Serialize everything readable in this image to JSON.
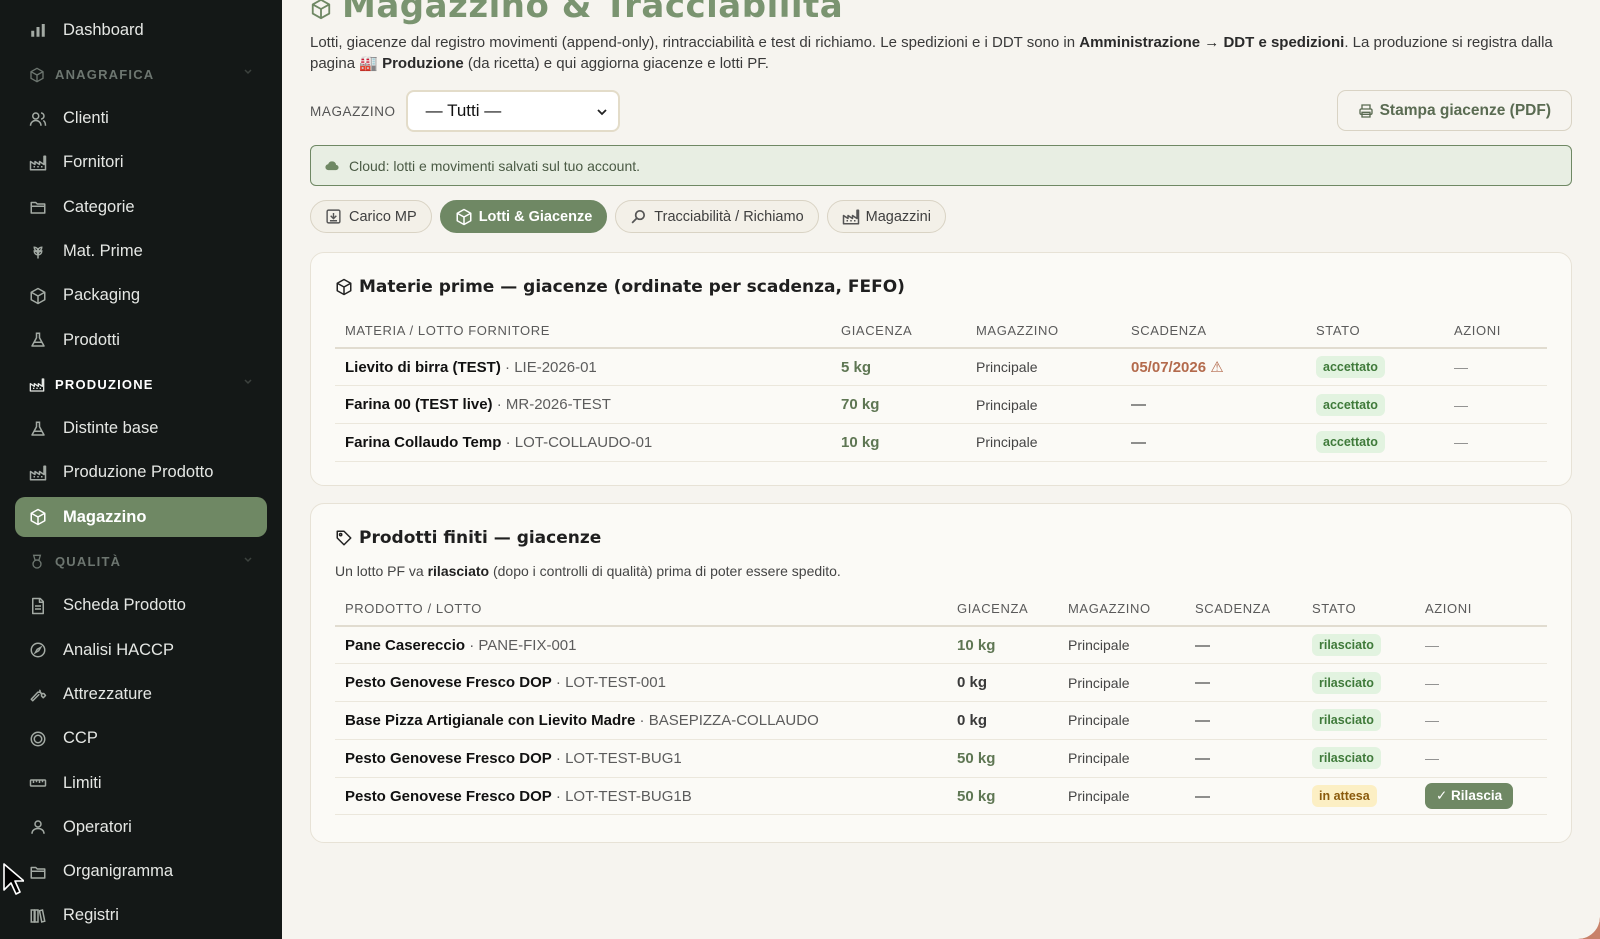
{
  "sidebar": {
    "items": [
      {
        "type": "item",
        "icon": "chart-icon",
        "label": "Dashboard"
      },
      {
        "type": "section",
        "icon": "box-icon",
        "label": "ANAGRAFICA"
      },
      {
        "type": "item",
        "icon": "users-icon",
        "label": "Clienti"
      },
      {
        "type": "item",
        "icon": "factory-icon",
        "label": "Fornitori"
      },
      {
        "type": "item",
        "icon": "folder-icon",
        "label": "Categorie"
      },
      {
        "type": "item",
        "icon": "wheat-icon",
        "label": "Mat. Prime"
      },
      {
        "type": "item",
        "icon": "box-icon",
        "label": "Packaging"
      },
      {
        "type": "item",
        "icon": "flask-icon",
        "label": "Prodotti"
      },
      {
        "type": "section",
        "icon": "factory-icon",
        "label": "PRODUZIONE"
      },
      {
        "type": "item",
        "icon": "flask-icon",
        "label": "Distinte base"
      },
      {
        "type": "item",
        "icon": "factory-icon",
        "label": "Produzione Prodotto"
      },
      {
        "type": "item",
        "icon": "box-icon",
        "label": "Magazzino",
        "active": true
      },
      {
        "type": "section",
        "icon": "medal-icon",
        "label": "QUALITÀ"
      },
      {
        "type": "item",
        "icon": "document-icon",
        "label": "Scheda Prodotto"
      },
      {
        "type": "item",
        "icon": "compass-icon",
        "label": "Analisi HACCP"
      },
      {
        "type": "item",
        "icon": "wrench-icon",
        "label": "Attrezzature"
      },
      {
        "type": "item",
        "icon": "target-icon",
        "label": "CCP"
      },
      {
        "type": "item",
        "icon": "ruler-icon",
        "label": "Limiti"
      },
      {
        "type": "item",
        "icon": "user-icon",
        "label": "Operatori"
      },
      {
        "type": "item",
        "icon": "folder-icon",
        "label": "Organigramma"
      },
      {
        "type": "item",
        "icon": "books-icon",
        "label": "Registri"
      }
    ]
  },
  "header": {
    "title": "Magazzino & Tracciabilità",
    "intro_1": "Lotti, giacenze dal registro movimenti (append-only), rintracciabilità e test di richiamo. Le spedizioni e i DDT sono in ",
    "intro_2": "Amministrazione → DDT e spedizioni",
    "intro_3": ". La produzione si registra dalla pagina 🏭 ",
    "intro_4": "Produzione",
    "intro_5": " (da ricetta) e qui aggiorna giacenze e lotti PF."
  },
  "toolbar": {
    "warehouse_label": "MAGAZZINO",
    "warehouse_value": "— Tutti —",
    "print_label": "Stampa giacenze (PDF)"
  },
  "cloud_notice": "Cloud: lotti e movimenti salvati sul tuo account.",
  "tabs": [
    {
      "icon": "download-icon",
      "label": "Carico MP"
    },
    {
      "icon": "box-icon",
      "label": "Lotti & Giacenze",
      "active": true
    },
    {
      "icon": "magnifier-icon",
      "label": "Tracciabilità / Richiamo"
    },
    {
      "icon": "factory-icon",
      "label": "Magazzini"
    }
  ],
  "raw_materials": {
    "title": "Materie prime — giacenze (ordinate per scadenza, FEFO)",
    "columns": [
      "MATERIA / LOTTO FORNITORE",
      "GIACENZA",
      "MAGAZZINO",
      "SCADENZA",
      "STATO",
      "AZIONI"
    ],
    "rows": [
      {
        "name": "Lievito di birra (TEST)",
        "lot": " · LIE-2026-01",
        "qty": "5 kg",
        "warehouse": "Principale",
        "expiry": "05/07/2026 ⚠",
        "expiry_warn": true,
        "status": "accettato",
        "action": "—"
      },
      {
        "name": "Farina 00 (TEST live)",
        "lot": " · MR-2026-TEST",
        "qty": "70 kg",
        "warehouse": "Principale",
        "expiry": "—",
        "status": "accettato",
        "action": "—"
      },
      {
        "name": "Farina Collaudo Temp",
        "lot": " · LOT-COLLAUDO-01",
        "qty": "10 kg",
        "warehouse": "Principale",
        "expiry": "—",
        "status": "accettato",
        "action": "—"
      }
    ]
  },
  "finished_products": {
    "title": "Prodotti finiti — giacenze",
    "note_1": "Un lotto PF va ",
    "note_2": "rilasciato",
    "note_3": " (dopo i controlli di qualità) prima di poter essere spedito.",
    "columns": [
      "PRODOTTO / LOTTO",
      "GIACENZA",
      "MAGAZZINO",
      "SCADENZA",
      "STATO",
      "AZIONI"
    ],
    "rows": [
      {
        "name": "Pane Casereccio",
        "lot": " · PANE-FIX-001",
        "qty": "10 kg",
        "qty_zero": false,
        "warehouse": "Principale",
        "expiry": "—",
        "status": "rilasciato",
        "action": "—"
      },
      {
        "name": "Pesto Genovese Fresco DOP",
        "lot": " · LOT-TEST-001",
        "qty": "0 kg",
        "qty_zero": true,
        "warehouse": "Principale",
        "expiry": "—",
        "status": "rilasciato",
        "action": "—"
      },
      {
        "name": "Base Pizza Artigianale con Lievito Madre",
        "lot": " · BASEPIZZA-COLLAUDO",
        "qty": "0 kg",
        "qty_zero": true,
        "warehouse": "Principale",
        "expiry": "—",
        "status": "rilasciato",
        "action": "—"
      },
      {
        "name": "Pesto Genovese Fresco DOP",
        "lot": " · LOT-TEST-BUG1",
        "qty": "50 kg",
        "qty_zero": false,
        "warehouse": "Principale",
        "expiry": "—",
        "status": "rilasciato",
        "action": "—"
      },
      {
        "name": "Pesto Genovese Fresco DOP",
        "lot": " · LOT-TEST-BUG1B",
        "qty": "50 kg",
        "qty_zero": false,
        "warehouse": "Principale",
        "expiry": "—",
        "status": "in attesa",
        "pending": true,
        "action_button": "✓ Rilascia"
      }
    ]
  }
}
